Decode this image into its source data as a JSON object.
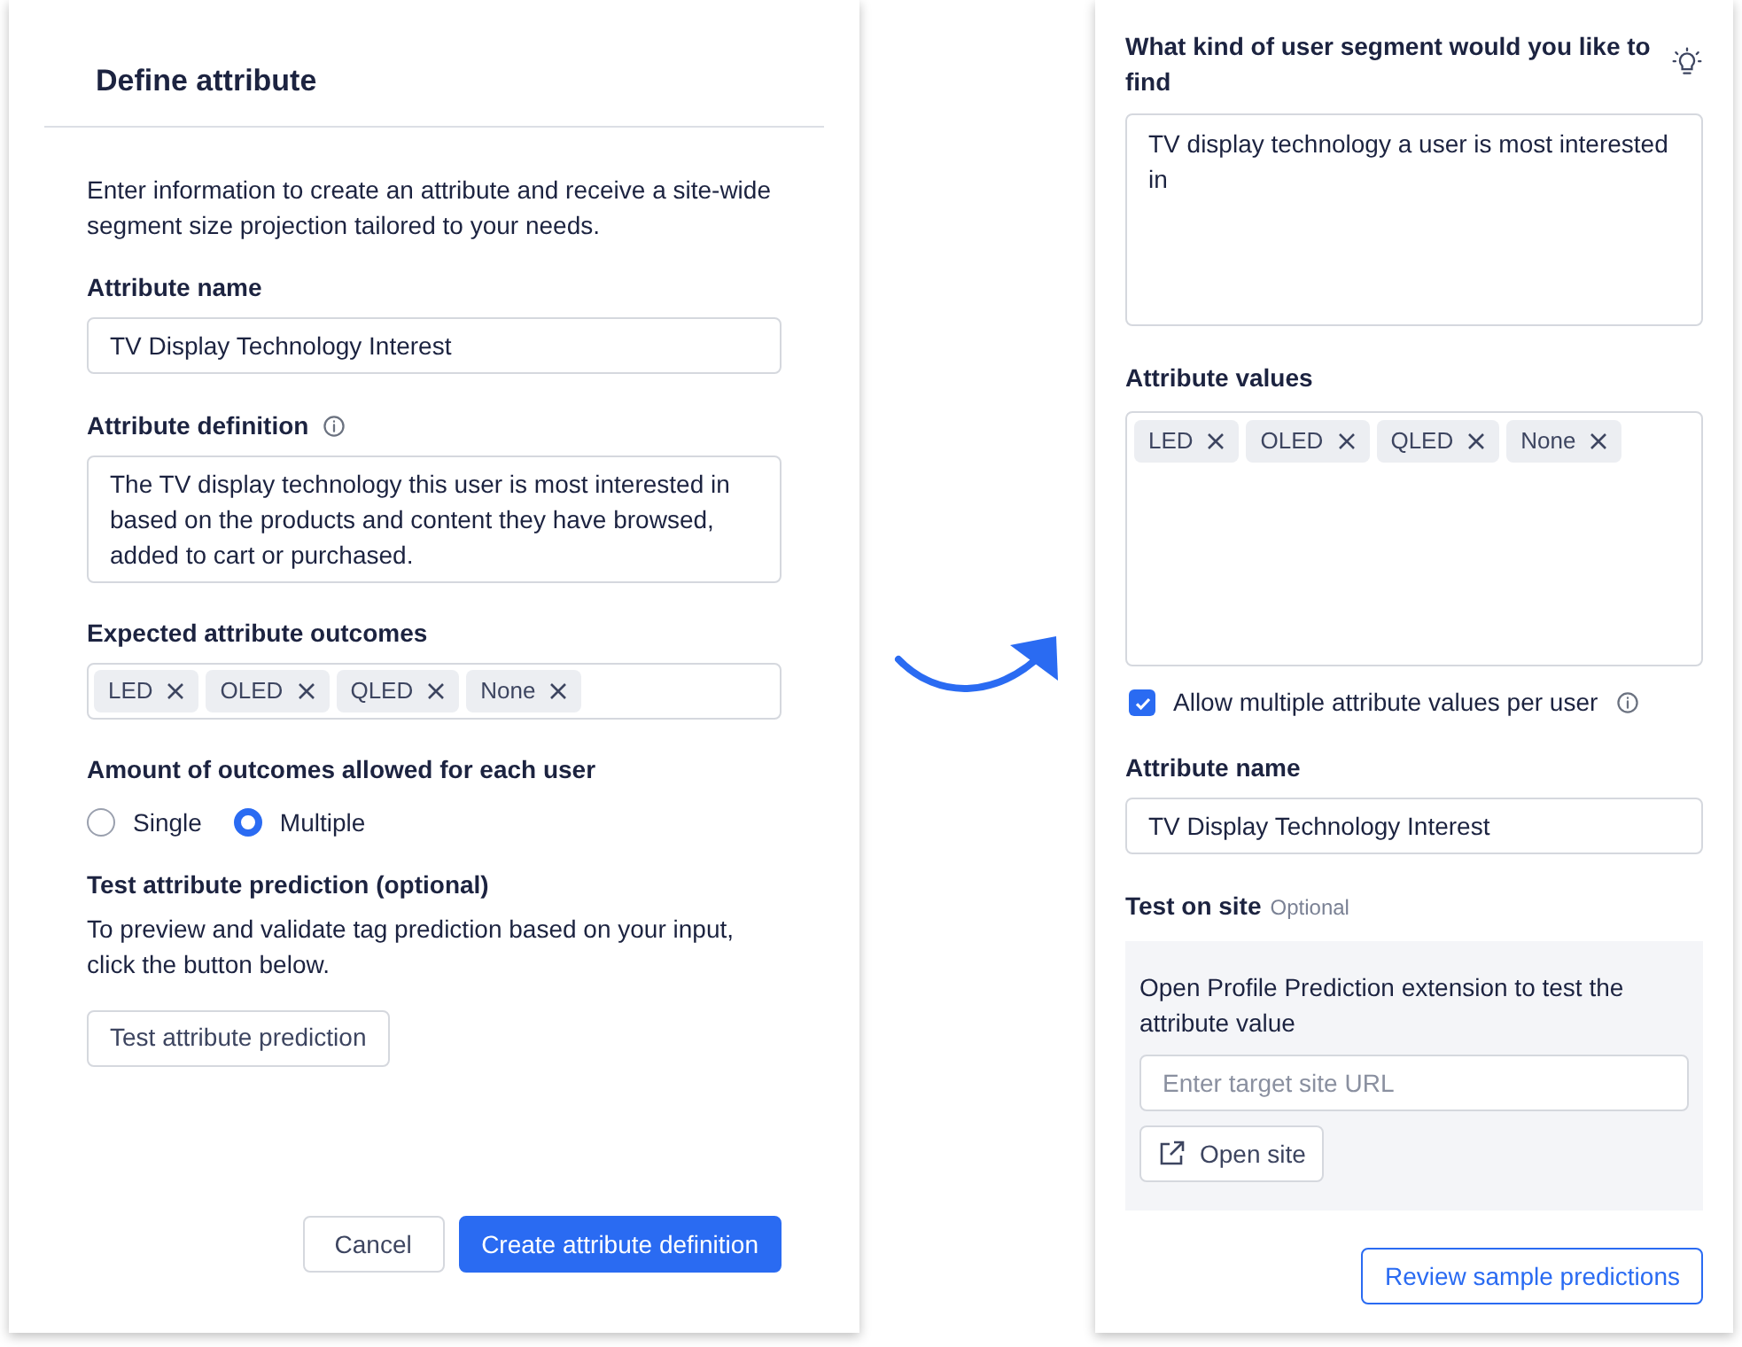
{
  "define_panel": {
    "title": "Define attribute",
    "intro": "Enter information to create an attribute and receive a site-wide segment size projection tailored to your needs.",
    "name_label": "Attribute name",
    "name_value": "TV Display Technology Interest",
    "definition_label": "Attribute definition",
    "definition_value": "The TV display technology this user is most interested in based on the products and content they have browsed, added to cart or purchased.",
    "outcomes_label": "Expected attribute outcomes",
    "outcomes": [
      "LED",
      "OLED",
      "QLED",
      "None"
    ],
    "amount_label": "Amount of outcomes allowed for each user",
    "amount_options": [
      {
        "label": "Single",
        "selected": false
      },
      {
        "label": "Multiple",
        "selected": true
      }
    ],
    "test_title": "Test attribute prediction (optional)",
    "test_description": "To preview and validate tag prediction based on your input, click the button below.",
    "test_button": "Test attribute prediction",
    "footer_buttons": [
      {
        "label": "Cancel",
        "kind": "secondary"
      },
      {
        "label": "Create attribute definition",
        "kind": "primary"
      }
    ]
  },
  "segment_panel": {
    "question_label": "What kind of user segment would you like to find",
    "question_value": "TV display technology a user is most interested in",
    "values_label": "Attribute values",
    "values": [
      "LED",
      "OLED",
      "QLED",
      "None"
    ],
    "allow_multiple": {
      "label": "Allow multiple attribute values per user",
      "checked": true
    },
    "name_label": "Attribute name",
    "name_value": "TV Display Technology Interest",
    "test_label": "Test on site",
    "test_optional": "Optional",
    "test_description": "Open Profile Prediction extension to test the attribute value",
    "url_placeholder": "Enter target site URL",
    "open_button": "Open site",
    "review_button": "Review sample predictions"
  }
}
